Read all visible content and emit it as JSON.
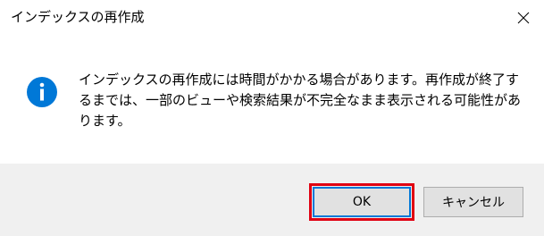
{
  "window": {
    "title": "インデックスの再作成",
    "close_icon": "close-icon"
  },
  "message": {
    "icon": "info-icon",
    "icon_color": "#0078d7",
    "text": "インデックスの再作成には時間がかかる場合があります。再作成が終了するまでは、一部のビューや検索結果が不完全なまま表示される可能性があります。"
  },
  "buttons": {
    "ok_label": "OK",
    "cancel_label": "キャンセル",
    "highlight_color": "#e00012"
  }
}
